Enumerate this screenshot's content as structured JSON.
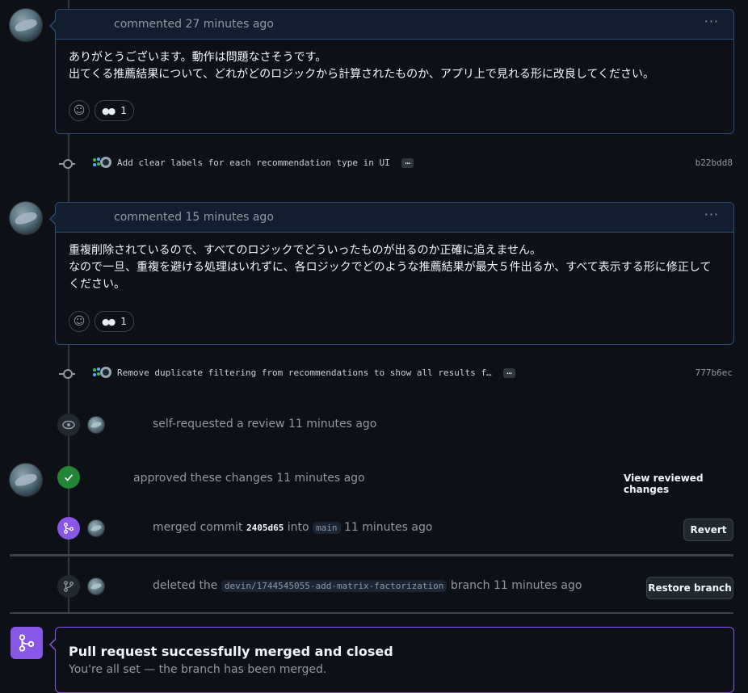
{
  "comments": [
    {
      "meta": "commented 27 minutes ago",
      "body_lines": [
        "ありがとうございます。動作は問題なさそうです。",
        "出てくる推薦結果について、どれがどのロジックから計算されたものか、アプリ上で見れる形に改良してください。"
      ],
      "reaction_count": "1",
      "menu_label": "···"
    },
    {
      "meta": "commented 15 minutes ago",
      "body_lines": [
        "重複削除されているので、すべてのロジックでどういったものが出るのか正確に追えません。",
        "なので一旦、重複を避ける処理はいれずに、各ロジックでどのような推薦結果が最大５件出るか、すべて表示する形に修正して",
        "ください。"
      ],
      "reaction_count": "1",
      "menu_label": "···"
    }
  ],
  "commits": [
    {
      "message": "Add clear labels for each recommendation type in UI",
      "more": "…",
      "sha": "b22bdd8"
    },
    {
      "message": "Remove duplicate filtering from recommendations to show all results f…",
      "more": "…",
      "sha": "777b6ec"
    }
  ],
  "events": {
    "review_requested": {
      "text": "self-requested a review 11 minutes ago"
    },
    "approved": {
      "text": "approved these changes 11 minutes ago",
      "button": "View reviewed changes"
    },
    "merged": {
      "prefix": "merged commit",
      "commit": "2405d65",
      "into": "into",
      "branch": "main",
      "time": "11 minutes ago",
      "button": "Revert"
    },
    "deleted": {
      "prefix": "deleted the",
      "branch": "devin/1744545055-add-matrix-factorization",
      "suffix": "branch 11 minutes ago",
      "button": "Restore branch"
    }
  },
  "merged_box": {
    "title": "Pull request successfully merged and closed",
    "subtitle": "You're all set — the branch has been merged."
  },
  "colors": {
    "background": "#0d1117",
    "comment_border": "#2f4b78",
    "approved_green": "#238636",
    "merged_purple": "#8957e5"
  }
}
